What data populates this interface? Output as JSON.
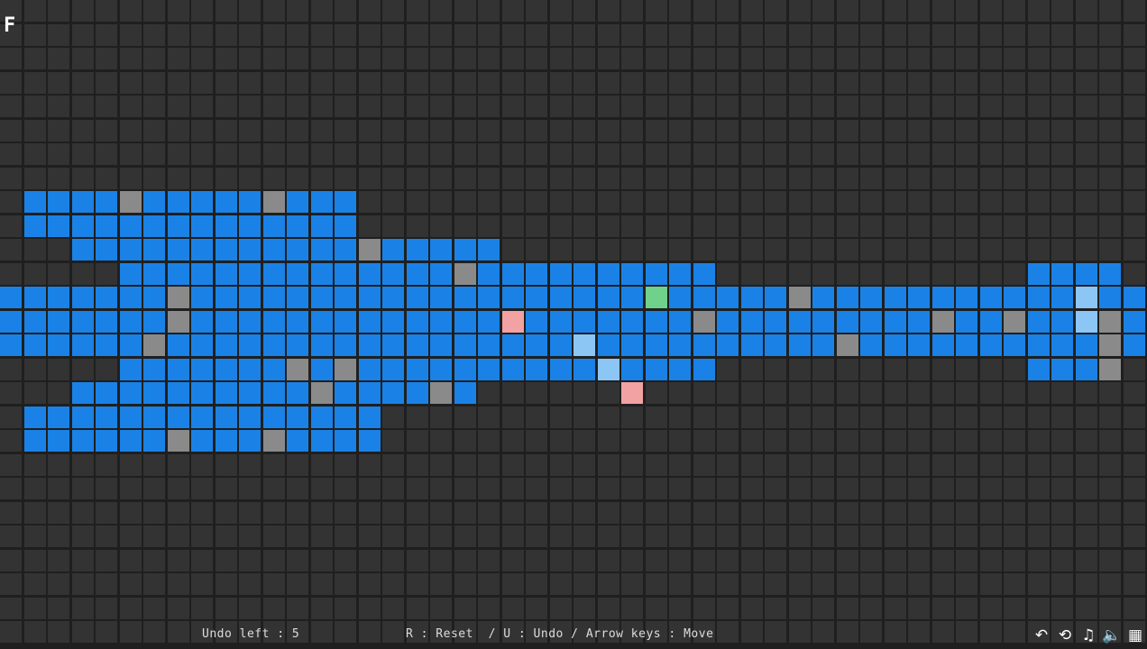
{
  "game": {
    "level_label": "F",
    "undo_text": "Undo left : 5",
    "help_text": "R : Reset  / U : Undo / Arrow keys : Move"
  },
  "colors": {
    "background": "#1f1f1f",
    "grid_cell": "#333333",
    "water": "#1a82e6",
    "stone": "#8a8a8a",
    "target_pink": "#f2a2a2",
    "goal_green": "#6fd18a",
    "ice_light": "#8cc6f5"
  },
  "grid": {
    "cols": 48,
    "rows": 27,
    "water_runs": [
      [
        8,
        1,
        14
      ],
      [
        9,
        1,
        14
      ],
      [
        10,
        3,
        20
      ],
      [
        11,
        5,
        29
      ],
      [
        12,
        0,
        47
      ],
      [
        13,
        0,
        47
      ],
      [
        14,
        0,
        47
      ],
      [
        15,
        5,
        29
      ],
      [
        16,
        3,
        19
      ],
      [
        17,
        1,
        15
      ],
      [
        18,
        1,
        15
      ],
      [
        11,
        43,
        46
      ],
      [
        15,
        43,
        46
      ]
    ],
    "special_cells": [
      {
        "row": 8,
        "col": 5,
        "type": "stone"
      },
      {
        "row": 8,
        "col": 11,
        "type": "stone"
      },
      {
        "row": 10,
        "col": 15,
        "type": "stone"
      },
      {
        "row": 11,
        "col": 19,
        "type": "stone"
      },
      {
        "row": 12,
        "col": 7,
        "type": "stone"
      },
      {
        "row": 12,
        "col": 27,
        "type": "goal"
      },
      {
        "row": 12,
        "col": 33,
        "type": "stone"
      },
      {
        "row": 12,
        "col": 45,
        "type": "ice"
      },
      {
        "row": 13,
        "col": 7,
        "type": "stone"
      },
      {
        "row": 13,
        "col": 21,
        "type": "target"
      },
      {
        "row": 13,
        "col": 29,
        "type": "stone"
      },
      {
        "row": 13,
        "col": 39,
        "type": "stone"
      },
      {
        "row": 13,
        "col": 42,
        "type": "stone"
      },
      {
        "row": 13,
        "col": 45,
        "type": "ice"
      },
      {
        "row": 13,
        "col": 46,
        "type": "stone"
      },
      {
        "row": 14,
        "col": 6,
        "type": "stone"
      },
      {
        "row": 14,
        "col": 24,
        "type": "ice"
      },
      {
        "row": 14,
        "col": 35,
        "type": "stone"
      },
      {
        "row": 14,
        "col": 46,
        "type": "stone"
      },
      {
        "row": 15,
        "col": 12,
        "type": "stone"
      },
      {
        "row": 15,
        "col": 14,
        "type": "stone"
      },
      {
        "row": 15,
        "col": 25,
        "type": "ice"
      },
      {
        "row": 15,
        "col": 46,
        "type": "stone"
      },
      {
        "row": 16,
        "col": 13,
        "type": "stone"
      },
      {
        "row": 16,
        "col": 18,
        "type": "stone"
      },
      {
        "row": 16,
        "col": 26,
        "type": "target"
      },
      {
        "row": 18,
        "col": 7,
        "type": "stone"
      },
      {
        "row": 18,
        "col": 11,
        "type": "stone"
      }
    ]
  },
  "toolbar": [
    {
      "name": "undo-icon",
      "glyph": "↶"
    },
    {
      "name": "restart-icon",
      "glyph": "⟲"
    },
    {
      "name": "music-icon",
      "glyph": "♫"
    },
    {
      "name": "sound-icon",
      "glyph": "🔈"
    },
    {
      "name": "menu-icon",
      "glyph": "▦"
    }
  ]
}
